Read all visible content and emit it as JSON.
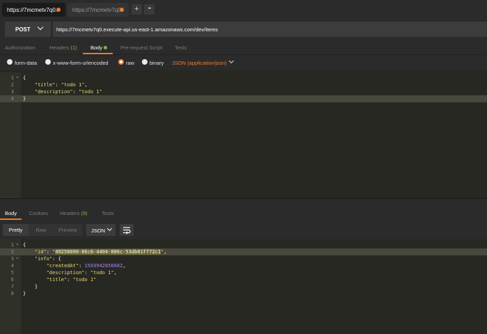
{
  "tabs": [
    {
      "label": "https://7mcmetv7q0.",
      "active": true
    },
    {
      "label": "https://7mcmetv7q0.",
      "active": false
    }
  ],
  "tab_actions": {
    "add": "+",
    "more": "•••"
  },
  "request": {
    "method": "POST",
    "url": "https://7mcmetv7q0.execute-api.us-east-1.amazonaws.com/dev/items"
  },
  "request_tabs": {
    "authorization": "Authorization",
    "headers": "Headers",
    "headers_count": "(1)",
    "body": "Body",
    "pre_request": "Pre-request Script",
    "tests": "Tests"
  },
  "body_options": {
    "form_data": "form-data",
    "urlencoded": "x-www-form-urlencoded",
    "raw": "raw",
    "binary": "binary",
    "content_type": "JSON (application/json)",
    "selected": "raw"
  },
  "request_body_lines": [
    {
      "n": "1",
      "fold": "▾",
      "parts": [
        [
          "p",
          "{"
        ]
      ]
    },
    {
      "n": "2",
      "fold": "",
      "parts": [
        [
          "p",
          "    "
        ],
        [
          "k",
          "\"title\""
        ],
        [
          "p",
          ": "
        ],
        [
          "s",
          "\"todo 1\""
        ],
        [
          "p",
          ","
        ]
      ]
    },
    {
      "n": "3",
      "fold": "",
      "parts": [
        [
          "p",
          "    "
        ],
        [
          "k",
          "\"description\""
        ],
        [
          "p",
          ": "
        ],
        [
          "s",
          "\"todo 1\""
        ]
      ]
    },
    {
      "n": "4",
      "fold": "",
      "parts": [
        [
          "p",
          "}"
        ]
      ],
      "highlight": true
    }
  ],
  "response_tabs": {
    "body": "Body",
    "cookies": "Cookies",
    "headers": "Headers",
    "headers_count": "(9)",
    "tests": "Tests"
  },
  "response_view": {
    "pretty": "Pretty",
    "raw": "Raw",
    "preview": "Preview",
    "format": "JSON"
  },
  "response_body_lines": [
    {
      "n": "1",
      "fold": "▾",
      "parts": [
        [
          "p",
          "{"
        ]
      ]
    },
    {
      "n": "2",
      "fold": "",
      "parts": [
        [
          "p",
          "    "
        ],
        [
          "k",
          "\"id\""
        ],
        [
          "p",
          ": "
        ],
        [
          "s",
          "\""
        ],
        [
          "sel",
          "49258090-86c6-4404-886c-53db81ff72c1"
        ],
        [
          "s",
          "\""
        ],
        [
          "p",
          ","
        ]
      ],
      "highlight": true
    },
    {
      "n": "3",
      "fold": "▾",
      "parts": [
        [
          "p",
          "    "
        ],
        [
          "k",
          "\"info\""
        ],
        [
          "p",
          ": {"
        ]
      ]
    },
    {
      "n": "4",
      "fold": "",
      "parts": [
        [
          "p",
          "        "
        ],
        [
          "k",
          "\"createdAt\""
        ],
        [
          "p",
          ": "
        ],
        [
          "n",
          "1503942856682"
        ],
        [
          "p",
          ","
        ]
      ]
    },
    {
      "n": "5",
      "fold": "",
      "parts": [
        [
          "p",
          "        "
        ],
        [
          "k",
          "\"description\""
        ],
        [
          "p",
          ": "
        ],
        [
          "s",
          "\"todo 1\""
        ],
        [
          "p",
          ","
        ]
      ]
    },
    {
      "n": "6",
      "fold": "",
      "parts": [
        [
          "p",
          "        "
        ],
        [
          "k",
          "\"title\""
        ],
        [
          "p",
          ": "
        ],
        [
          "s",
          "\"todo 1\""
        ]
      ]
    },
    {
      "n": "7",
      "fold": "",
      "parts": [
        [
          "p",
          "    }"
        ]
      ]
    },
    {
      "n": "8",
      "fold": "",
      "parts": [
        [
          "p",
          "}"
        ]
      ]
    }
  ],
  "colors": {
    "accent": "#ef7c2b",
    "success": "#6fbf3f",
    "editor_bg": "#272822"
  }
}
